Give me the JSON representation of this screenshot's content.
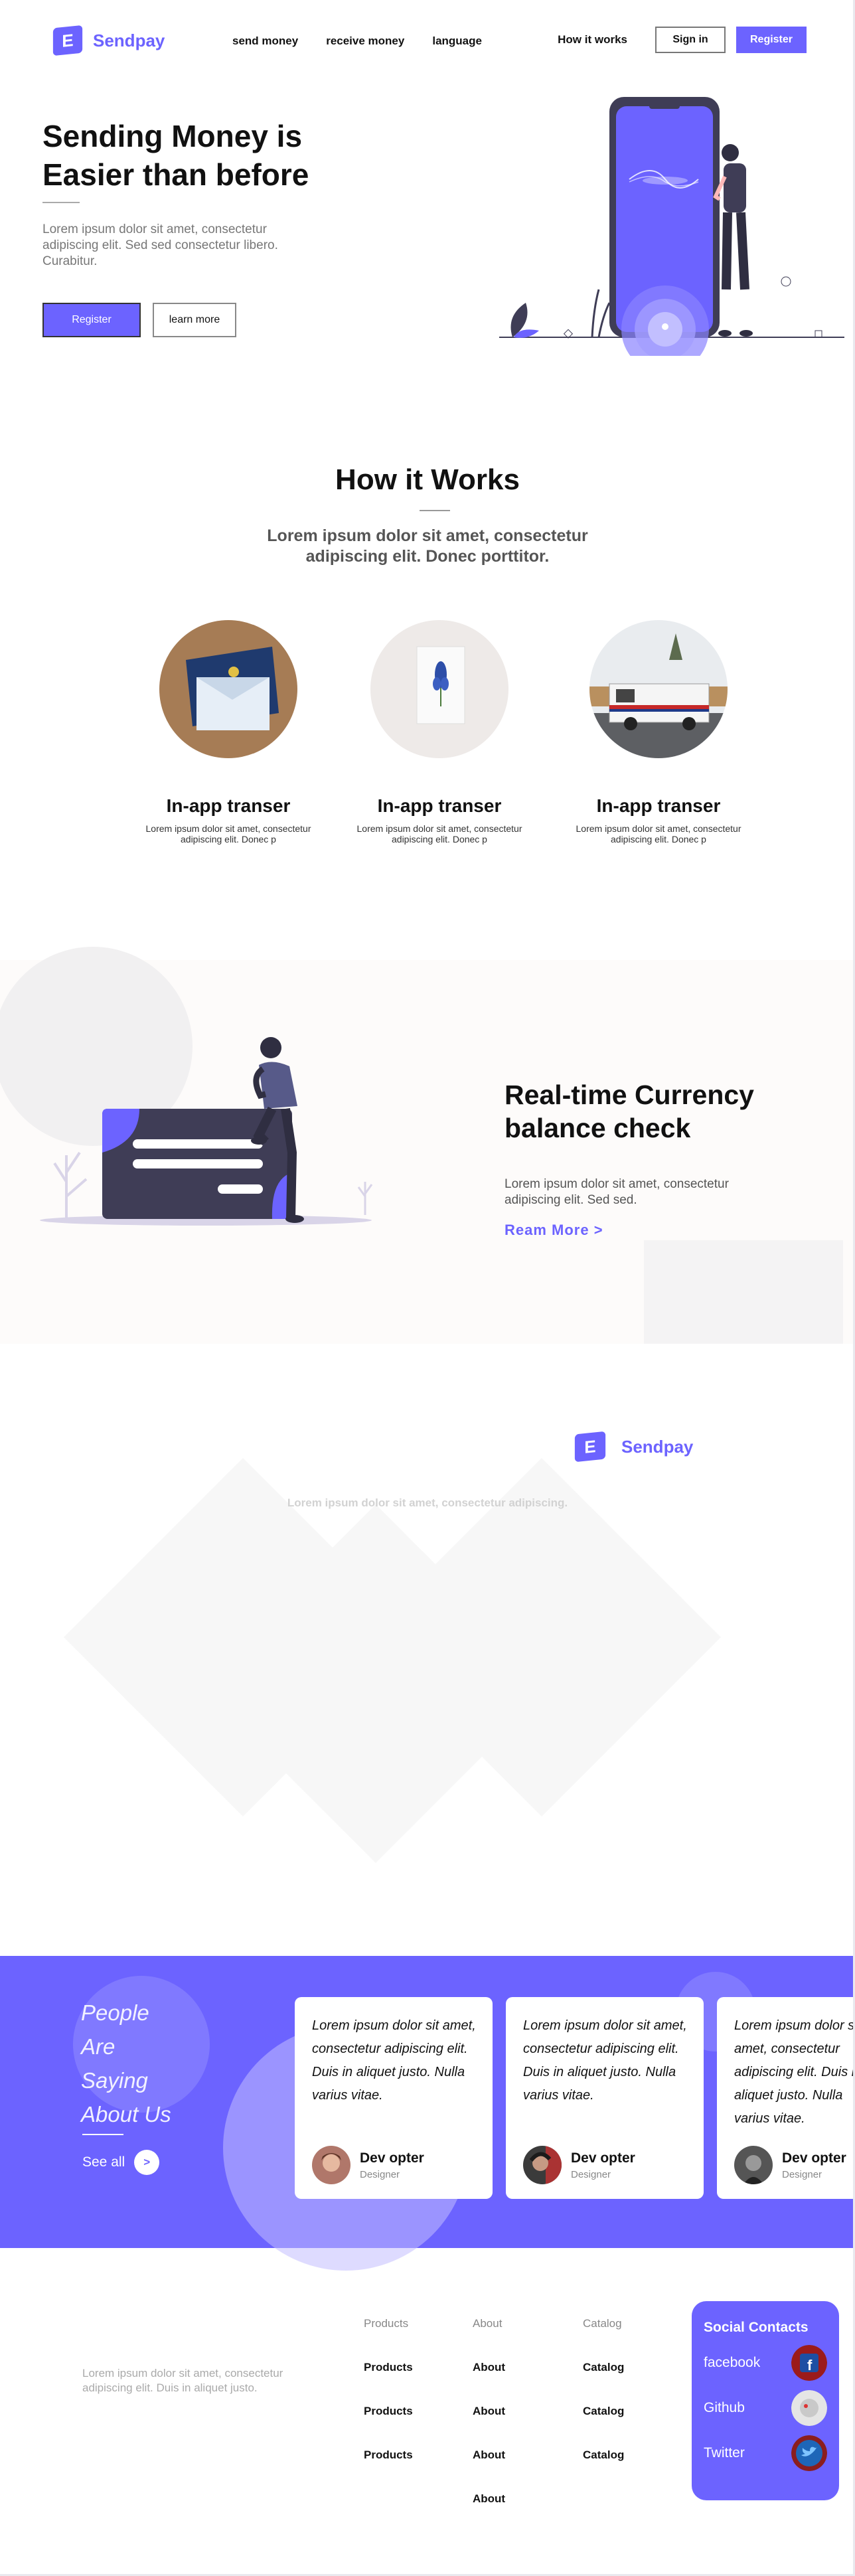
{
  "brand": {
    "name": "Sendpay",
    "logo_letter": "E",
    "accent": "#6c63ff"
  },
  "nav": {
    "links": [
      "send money",
      "receive money",
      "language"
    ],
    "how_it_works": "How it works",
    "sign_in": "Sign in",
    "register": "Register"
  },
  "hero": {
    "title": "Sending Money is Easier than before",
    "text": "Lorem ipsum dolor sit amet, consectetur adipiscing elit. Sed sed consectetur libero. Curabitur.",
    "register_label": "Register",
    "learn_label": "learn more"
  },
  "how": {
    "title": "How it Works",
    "subtitle": "Lorem ipsum dolor sit amet, consectetur adipiscing elit. Donec porttitor.",
    "features": [
      {
        "title": "In-app transer",
        "text": "Lorem ipsum dolor sit amet, consectetur adipiscing elit. Donec p",
        "image": "envelope-photo"
      },
      {
        "title": "In-app transer",
        "text": "Lorem ipsum dolor sit amet, consectetur adipiscing elit. Donec p",
        "image": "flower-card-photo"
      },
      {
        "title": "In-app transer",
        "text": "Lorem ipsum dolor sit amet, consectetur adipiscing elit. Donec p",
        "image": "mail-truck-photo"
      }
    ]
  },
  "currency": {
    "title": "Real-time Currency balance check",
    "text": "Lorem ipsum dolor sit amet, consectetur adipiscing elit. Sed sed.",
    "link": "Ream More >"
  },
  "brand_section": {
    "name": "Sendpay",
    "text": "Lorem ipsum dolor sit amet, consectetur adipiscing."
  },
  "testimonials": {
    "heading_lines": [
      "People",
      "Are",
      "Saying",
      "About Us"
    ],
    "see_all": "See all",
    "arrow": ">",
    "cards": [
      {
        "quote": "Lorem ipsum dolor sit amet, consectetur adipiscing elit. Duis in aliquet justo. Nulla varius vitae.",
        "name": "Dev opter",
        "role": "Designer"
      },
      {
        "quote": "Lorem ipsum dolor sit amet, consectetur adipiscing elit. Duis in aliquet justo. Nulla varius vitae.",
        "name": "Dev opter",
        "role": "Designer"
      },
      {
        "quote": "Lorem ipsum dolor sit amet, consectetur adipiscing elit. Duis in aliquet justo. Nulla varius vitae.",
        "name": "Dev opter",
        "role": "Designer"
      }
    ]
  },
  "footer": {
    "text": "Lorem ipsum dolor sit amet, consectetur adipiscing elit. Duis in aliquet justo.",
    "columns": [
      {
        "head": "Products",
        "items": [
          "Products",
          "Products",
          "Products"
        ]
      },
      {
        "head": "About",
        "items": [
          "About",
          "About",
          "About",
          "About"
        ]
      },
      {
        "head": "Catalog",
        "items": [
          "Catalog",
          "Catalog",
          "Catalog"
        ]
      }
    ],
    "social": {
      "title": "Social Contacts",
      "links": [
        {
          "label": "facebook",
          "icon": "facebook-icon"
        },
        {
          "label": "Github",
          "icon": "github-icon"
        },
        {
          "label": "Twitter",
          "icon": "twitter-icon"
        }
      ]
    }
  }
}
